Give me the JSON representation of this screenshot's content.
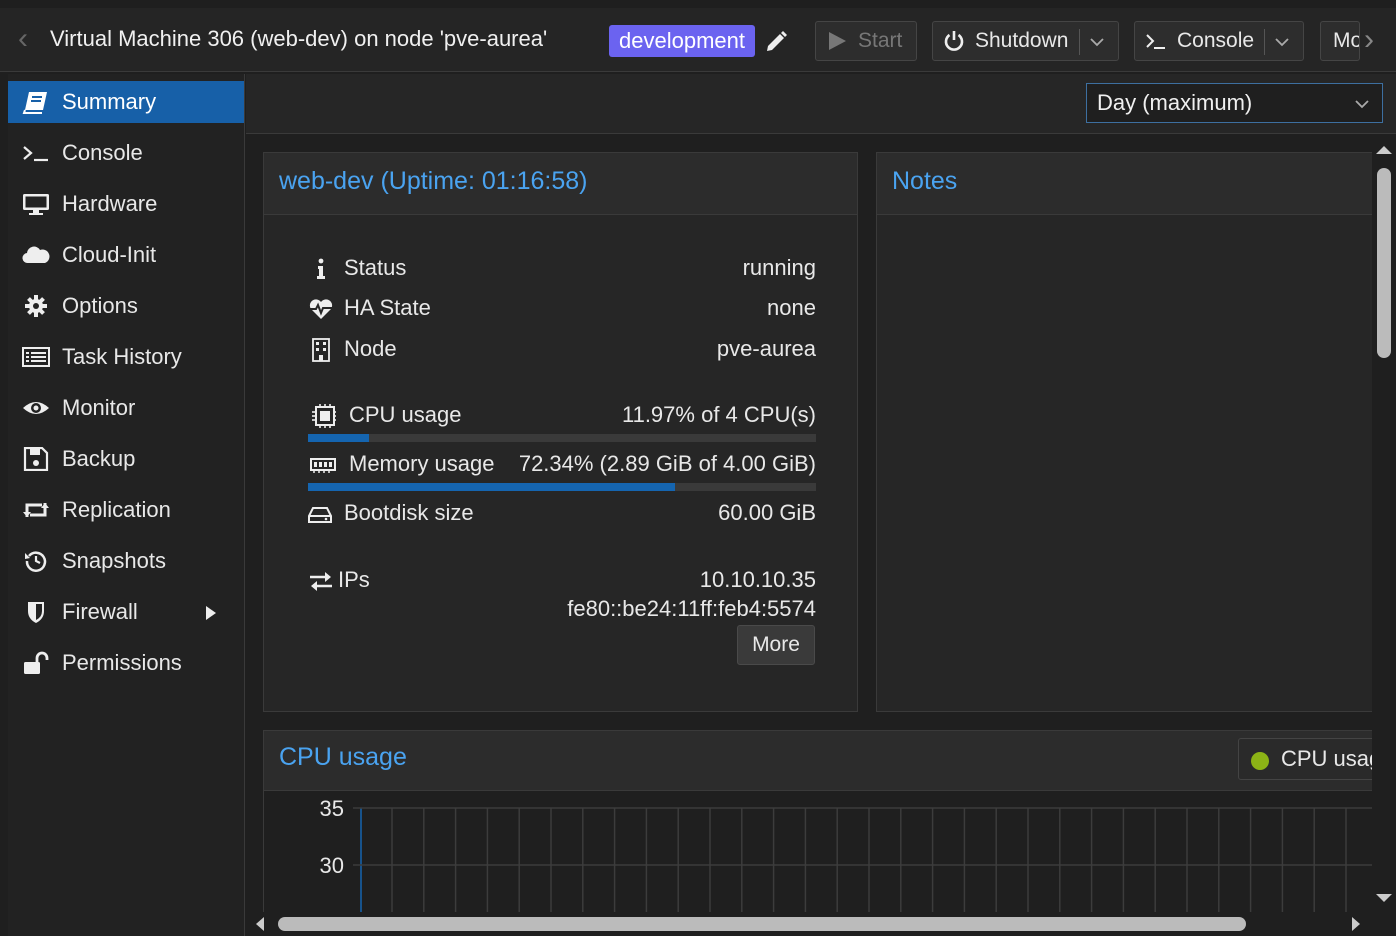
{
  "header": {
    "title": "Virtual Machine 306 (web-dev) on node 'pve-aurea'",
    "tag": "development",
    "tag_color": "#6b63f0",
    "buttons": {
      "start": "Start",
      "shutdown": "Shutdown",
      "console": "Console",
      "more": "Mo"
    }
  },
  "sidebar": {
    "active_color": "#1760a8",
    "items": [
      {
        "label": "Summary",
        "icon": "book-icon"
      },
      {
        "label": "Console",
        "icon": "terminal-icon"
      },
      {
        "label": "Hardware",
        "icon": "desktop-icon"
      },
      {
        "label": "Cloud-Init",
        "icon": "cloud-icon"
      },
      {
        "label": "Options",
        "icon": "gear-icon"
      },
      {
        "label": "Task History",
        "icon": "list-icon"
      },
      {
        "label": "Monitor",
        "icon": "eye-icon"
      },
      {
        "label": "Backup",
        "icon": "floppy-icon"
      },
      {
        "label": "Replication",
        "icon": "retweet-icon"
      },
      {
        "label": "Snapshots",
        "icon": "history-icon"
      },
      {
        "label": "Firewall",
        "icon": "shield-icon"
      },
      {
        "label": "Permissions",
        "icon": "unlock-icon"
      }
    ]
  },
  "timeframe": {
    "selected": "Day (maximum)"
  },
  "status_panel": {
    "title": "web-dev (Uptime: 01:16:58)",
    "rows": {
      "status": {
        "label": "Status",
        "value": "running"
      },
      "ha_state": {
        "label": "HA State",
        "value": "none"
      },
      "node": {
        "label": "Node",
        "value": "pve-aurea"
      },
      "cpu": {
        "label": "CPU usage",
        "value": "11.97% of 4 CPU(s)",
        "fraction": 0.1197
      },
      "memory": {
        "label": "Memory usage",
        "value": "72.34% (2.89 GiB of 4.00 GiB)",
        "fraction": 0.7234
      },
      "bootdisk": {
        "label": "Bootdisk size",
        "value": "60.00 GiB"
      },
      "ips": {
        "label": "IPs",
        "ipv4": "10.10.10.35",
        "ipv6": "fe80::be24:11ff:feb4:5574"
      }
    },
    "more_label": "More"
  },
  "notes_panel": {
    "title": "Notes"
  },
  "cpu_chart_panel": {
    "title": "CPU usage",
    "legend_label": "CPU usage",
    "legend_color": "#8cb316"
  },
  "chart_data": {
    "type": "line",
    "title": "CPU usage",
    "y_ticks": [
      "35",
      "30"
    ],
    "series": [
      {
        "name": "CPU usage",
        "values": []
      }
    ],
    "grid": true
  }
}
